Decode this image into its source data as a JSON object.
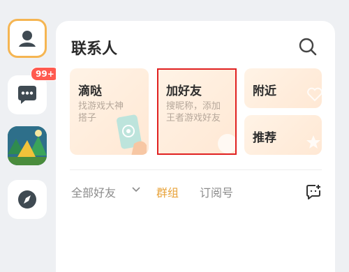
{
  "sidebar": {
    "badge": "99+",
    "icons": [
      "avatar-icon",
      "chat-bubble-icon",
      "game-thumbnail",
      "compass-icon"
    ]
  },
  "panel": {
    "title": "联系人",
    "search_icon": "search-icon"
  },
  "cards": {
    "didi": {
      "title": "滴哒",
      "subtitle_line1": "找游戏大神",
      "subtitle_line2": "搭子"
    },
    "add_friend": {
      "title": "加好友",
      "subtitle_line1": "搜昵称，添加",
      "subtitle_line2": "王者游戏好友"
    },
    "nearby": {
      "title": "附近"
    },
    "recommend": {
      "title": "推荐"
    }
  },
  "tabs": {
    "all_friends": "全部好友",
    "groups": "群组",
    "subscriptions": "订阅号",
    "active": "群组"
  },
  "colors": {
    "accent": "#e8a33a",
    "badge": "#ff5a4f",
    "highlight_box": "#e02020",
    "card_bg": "#ffeedd"
  }
}
